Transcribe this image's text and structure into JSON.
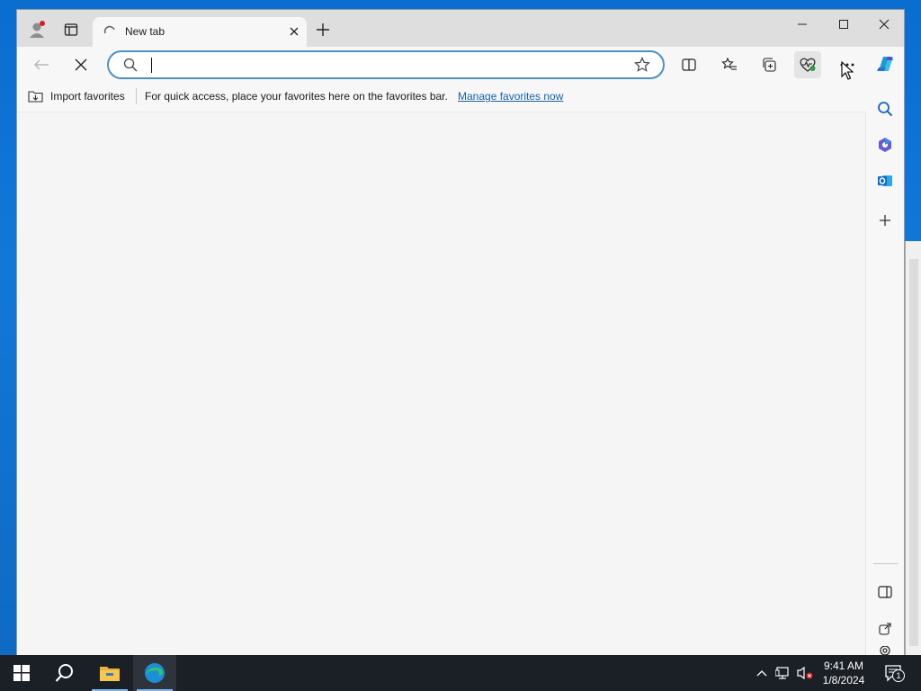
{
  "browser": {
    "tab": {
      "title": "New tab"
    },
    "address": {
      "value": "",
      "placeholder": ""
    },
    "favorites_bar": {
      "import_label": "Import favorites",
      "message": "For quick access, place your favorites here on the favorites bar.",
      "manage_link": "Manage favorites now"
    },
    "accent_color": "#1a5fa8"
  },
  "taskbar": {
    "time": "9:41 AM",
    "date": "1/8/2024",
    "notification_count": "1",
    "pinned": [
      "start-icon",
      "search-icon",
      "file-explorer-icon",
      "edge-icon"
    ]
  }
}
